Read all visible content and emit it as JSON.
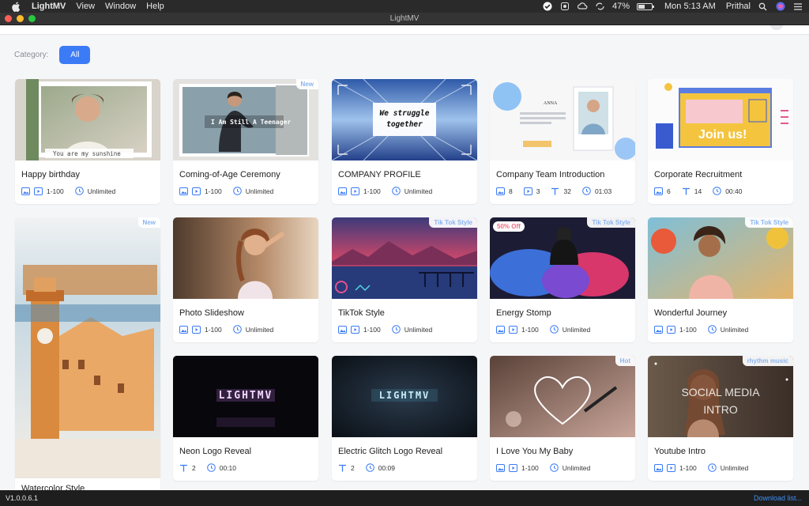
{
  "menubar": {
    "app_name": "LightMV",
    "menus": [
      "View",
      "Window",
      "Help"
    ],
    "battery": "47%",
    "clock": "Mon 5:13 AM",
    "user": "Prithal"
  },
  "window": {
    "title": "LightMV"
  },
  "filter": {
    "label": "Category:",
    "selected": "All"
  },
  "cards": [
    {
      "name": "Happy birthday",
      "meta": [
        "1-100",
        "Unlimited"
      ],
      "caption": "You are my sunshine"
    },
    {
      "name": "Coming-of-Age Ceremony",
      "meta": [
        "1-100",
        "Unlimited"
      ],
      "tag": "New",
      "caption": "I Am Still A Teenager"
    },
    {
      "name": "COMPANY PROFILE",
      "meta": [
        "1-100",
        "Unlimited"
      ],
      "caption_lines": [
        "We struggle",
        "together"
      ]
    },
    {
      "name": "Company Team Introduction",
      "meta": [
        "8",
        "3",
        "32",
        "01:03"
      ],
      "caption": "ANNA"
    },
    {
      "name": "Corporate Recruitment",
      "meta": [
        "6",
        "14",
        "00:40"
      ],
      "caption": "Join us!"
    },
    {
      "name": "Watercolor Style",
      "tag": "New"
    },
    {
      "name": "Photo Slideshow",
      "meta": [
        "1-100",
        "Unlimited"
      ]
    },
    {
      "name": "TikTok Style",
      "meta": [
        "1-100",
        "Unlimited"
      ],
      "tag": "Tik Tok Style"
    },
    {
      "name": "Energy Stomp",
      "meta": [
        "1-100",
        "Unlimited"
      ],
      "tag": "Tik Tok Style",
      "badge": "50% Off"
    },
    {
      "name": "Wonderful Journey",
      "meta": [
        "1-100",
        "Unlimited"
      ],
      "tag": "Tik Tok Style"
    },
    {
      "name": "Neon Logo Reveal",
      "meta": [
        "2",
        "00:10"
      ],
      "caption": "LIGHTMV"
    },
    {
      "name": "Electric Glitch Logo Reveal",
      "meta": [
        "2",
        "00:09"
      ],
      "caption": "LIGHTMV"
    },
    {
      "name": "I Love You My Baby",
      "meta": [
        "1-100",
        "Unlimited"
      ],
      "tag": "Hot"
    },
    {
      "name": "Youtube Intro",
      "meta": [
        "1-100",
        "Unlimited"
      ],
      "tag": "rhythm music",
      "caption_lines": [
        "SOCIAL MEDIA",
        "INTRO"
      ]
    }
  ],
  "footer": {
    "version": "V1.0.0.6.1",
    "download": "Download list..."
  },
  "colors": {
    "accent": "#3b7bf6",
    "tag_text": "#8bb4f0",
    "link": "#3f8ef6"
  }
}
